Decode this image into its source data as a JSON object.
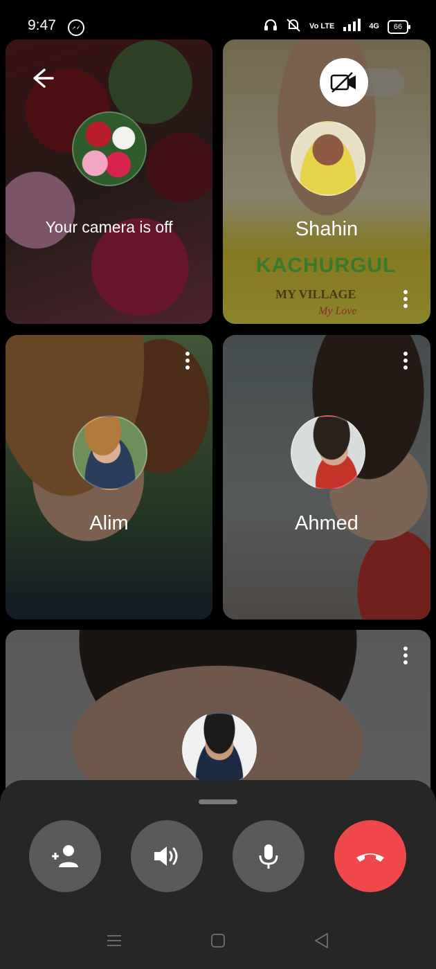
{
  "status_bar": {
    "time": "9:47",
    "network_label": "Vo LTE",
    "signal_label": "4G",
    "battery": "66"
  },
  "tiles": {
    "self": {
      "status_text": "Your camera is off"
    },
    "p1": {
      "name": "Shahin",
      "banner_text": "KACHURGUL",
      "sub_text": "MY VILLAGE",
      "sub_text2": "My Love"
    },
    "p2": {
      "name": "Alim"
    },
    "p3": {
      "name": "Ahmed"
    },
    "p4": {
      "name": ""
    }
  },
  "controls": {
    "add_person": "add-person-icon",
    "speaker": "speaker-icon",
    "mic": "mic-icon",
    "end_call": "end-call-icon"
  },
  "colors": {
    "end_call": "#f0474b",
    "control_bg": "#5a5a5a",
    "sheet_bg": "#262626"
  }
}
